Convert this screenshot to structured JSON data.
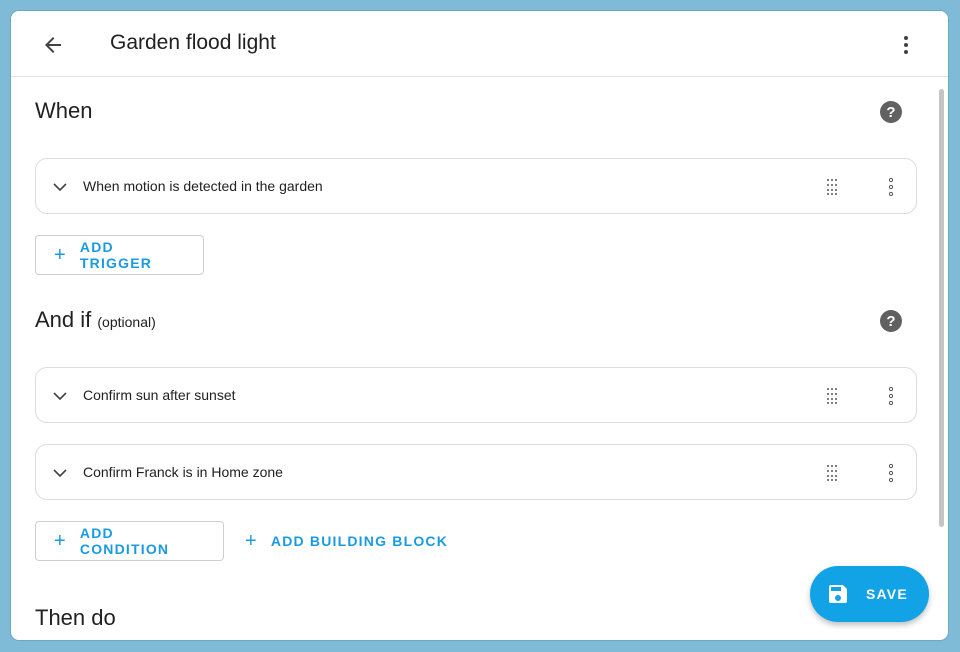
{
  "header": {
    "title": "Garden flood light"
  },
  "sections": {
    "when": {
      "title": "When"
    },
    "and_if": {
      "title": "And if",
      "optional": "(optional)"
    },
    "then_do": {
      "title": "Then do"
    }
  },
  "triggers": [
    {
      "label": "When motion is detected in the garden"
    }
  ],
  "conditions": [
    {
      "label": "Confirm sun after sunset"
    },
    {
      "label": "Confirm Franck is in Home zone"
    }
  ],
  "buttons": {
    "add_trigger": "ADD TRIGGER",
    "add_condition": "ADD CONDITION",
    "add_building_block": "ADD BUILDING BLOCK",
    "save": "SAVE"
  },
  "icons": {
    "back": "arrow-left-icon",
    "overflow": "dots-vertical-icon",
    "help": "help-circle-icon",
    "expand": "chevron-down-icon",
    "drag": "drag-handle-icon",
    "save": "floppy-disk-icon"
  },
  "colors": {
    "accent": "#1a9be0",
    "fab": "#12a3e6",
    "frame": "#7fbad6"
  }
}
